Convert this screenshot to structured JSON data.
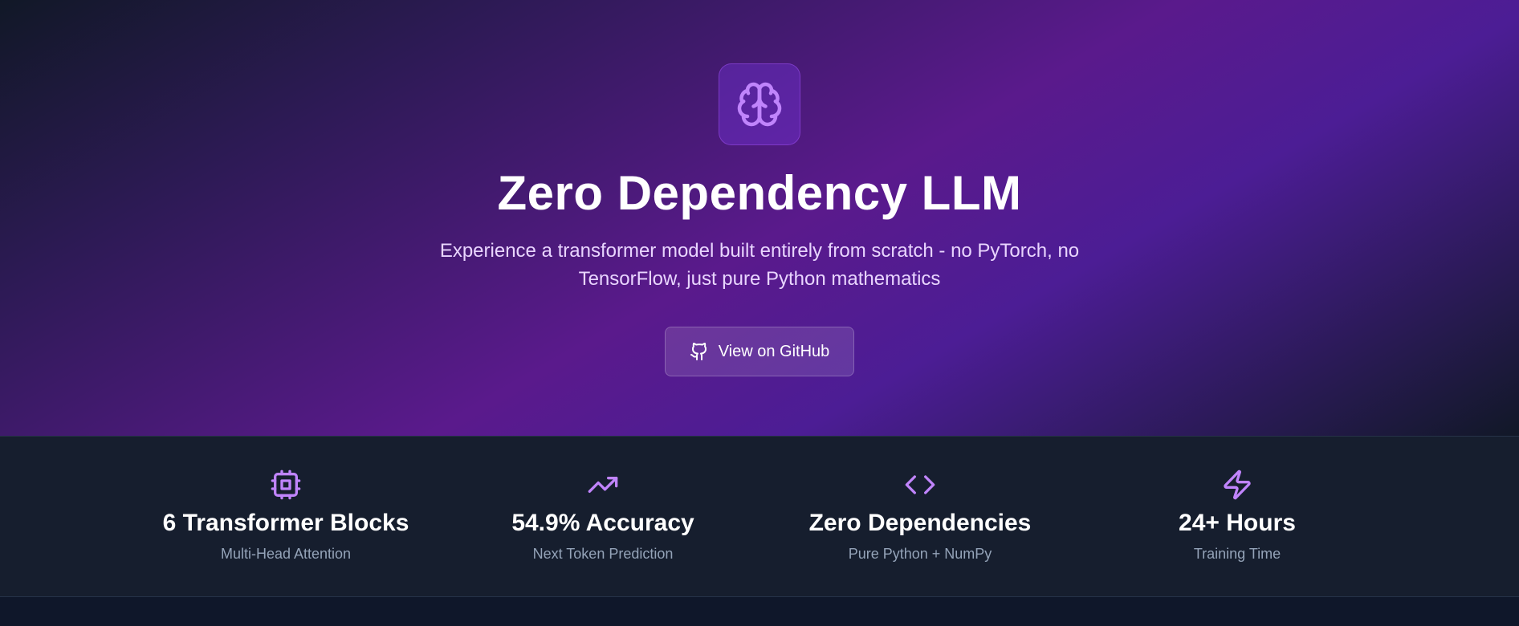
{
  "hero": {
    "logo_icon": "brain-icon",
    "title": "Zero Dependency LLM",
    "subtitle": "Experience a transformer model built entirely from scratch - no PyTorch, no TensorFlow, just pure Python mathematics",
    "github_button": {
      "icon": "github-icon",
      "label": "View on GitHub"
    }
  },
  "stats": [
    {
      "icon": "cpu-icon",
      "value": "6 Transformer Blocks",
      "label": "Multi-Head Attention"
    },
    {
      "icon": "trending-up-icon",
      "value": "54.9% Accuracy",
      "label": "Next Token Prediction"
    },
    {
      "icon": "code-icon",
      "value": "Zero Dependencies",
      "label": "Pure Python + NumPy"
    },
    {
      "icon": "zap-icon",
      "value": "24+ Hours",
      "label": "Training Time"
    }
  ],
  "colors": {
    "accent": "#c084fc",
    "stat_bg": "#161e2e",
    "muted": "#94a3b8"
  }
}
